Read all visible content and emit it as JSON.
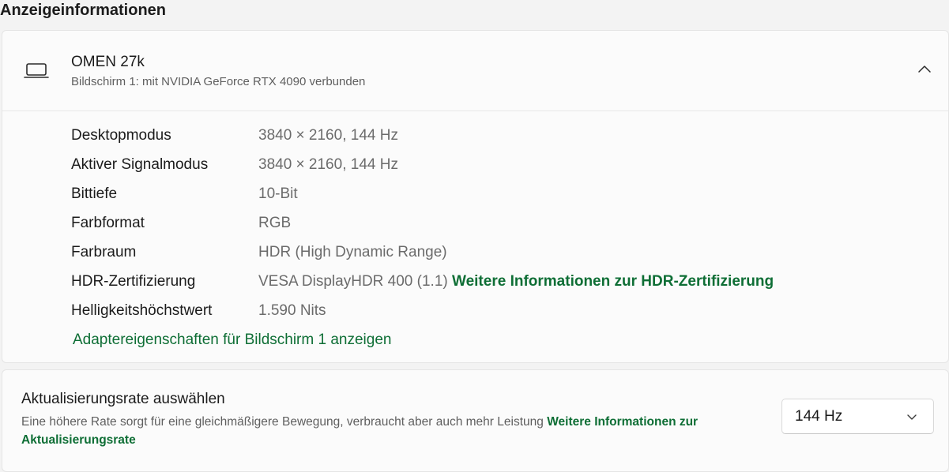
{
  "section_title": "Anzeigeinformationen",
  "monitor": {
    "name": "OMEN 27k",
    "subtitle": "Bildschirm 1: mit NVIDIA GeForce RTX 4090 verbunden",
    "icon": "laptop-icon",
    "expanded": true
  },
  "details": [
    {
      "label": "Desktopmodus",
      "value": "3840 × 2160, 144 Hz"
    },
    {
      "label": "Aktiver Signalmodus",
      "value": "3840 × 2160, 144 Hz"
    },
    {
      "label": "Bittiefe",
      "value": "10-Bit"
    },
    {
      "label": "Farbformat",
      "value": "RGB"
    },
    {
      "label": "Farbraum",
      "value": "HDR (High Dynamic Range)"
    },
    {
      "label": "HDR-Zertifizierung",
      "value": "VESA DisplayHDR 400 (1.1)",
      "link": "Weitere Informationen zur HDR-Zertifizierung"
    },
    {
      "label": "Helligkeitshöchstwert",
      "value": "1.590 Nits"
    }
  ],
  "adapter_link": "Adaptereigenschaften für Bildschirm 1 anzeigen",
  "refresh": {
    "title": "Aktualisierungsrate auswählen",
    "description": "Eine höhere Rate sorgt für eine gleichmäßigere Bewegung, verbraucht aber auch mehr Leistung",
    "link": "Weitere Informationen zur Aktualisierungsrate",
    "selected": "144 Hz"
  },
  "colors": {
    "accent": "#0e6e35",
    "background": "#f3f3f3",
    "card": "#fbfbfb"
  }
}
